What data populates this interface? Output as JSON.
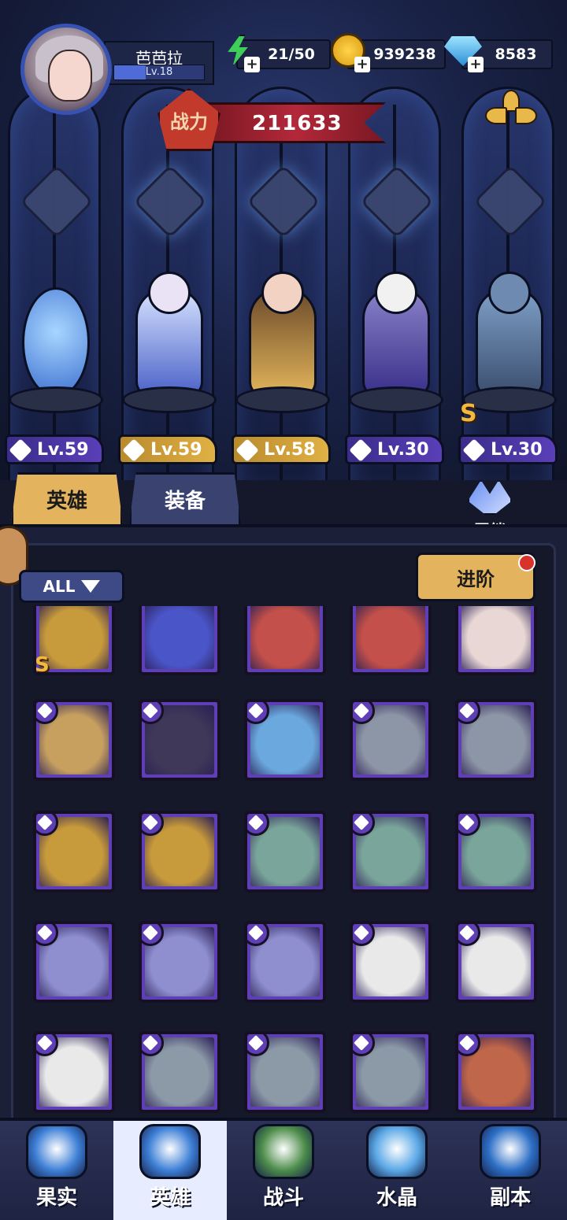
{
  "player": {
    "name": "芭芭拉",
    "level": "Lv.18",
    "level_progress": 0.35
  },
  "resources": {
    "energy": "21/50",
    "gold": "939238",
    "gems": "8583"
  },
  "power": {
    "label": "战力",
    "value": "211633"
  },
  "lineup": [
    {
      "level": "Lv.59",
      "class_icon": "wrench-icon",
      "color": "#4b3aa8"
    },
    {
      "level": "Lv.59",
      "class_icon": "hat-icon",
      "color": "#c89435"
    },
    {
      "level": "Lv.58",
      "class_icon": "wing-icon",
      "color": "#c89435"
    },
    {
      "level": "Lv.30",
      "class_icon": "hat-icon",
      "color": "#4b3aa8"
    },
    {
      "level": "Lv.30",
      "class_icon": "claw-icon",
      "color": "#4b3aa8"
    }
  ],
  "tabs": {
    "heroes": "英雄",
    "equipment": "装备",
    "bond": "羁绊"
  },
  "filter": "ALL",
  "advance": "进阶",
  "grid": [
    {
      "portrait": "#c79a3b",
      "cls": false,
      "s": true
    },
    {
      "portrait": "#4a55c8",
      "cls": false,
      "s": false
    },
    {
      "portrait": "#c3504a",
      "cls": false,
      "s": false
    },
    {
      "portrait": "#c3504a",
      "cls": false,
      "s": false
    },
    {
      "portrait": "#e8d7d4",
      "cls": false,
      "s": false
    },
    {
      "portrait": "#c7a060",
      "cls": true,
      "s": false
    },
    {
      "portrait": "#3f3858",
      "cls": true,
      "s": false
    },
    {
      "portrait": "#6aa8de",
      "cls": true,
      "s": false
    },
    {
      "portrait": "#8d96a6",
      "cls": true,
      "s": false
    },
    {
      "portrait": "#8d96a6",
      "cls": true,
      "s": false
    },
    {
      "portrait": "#c79a3b",
      "cls": true,
      "s": false
    },
    {
      "portrait": "#c79a3b",
      "cls": true,
      "s": false
    },
    {
      "portrait": "#7aa59a",
      "cls": true,
      "s": false
    },
    {
      "portrait": "#7aa59a",
      "cls": true,
      "s": false
    },
    {
      "portrait": "#7aa59a",
      "cls": true,
      "s": false
    },
    {
      "portrait": "#8f8fd0",
      "cls": true,
      "s": false
    },
    {
      "portrait": "#8f8fd0",
      "cls": true,
      "s": false
    },
    {
      "portrait": "#8f8fd0",
      "cls": true,
      "s": false
    },
    {
      "portrait": "#e9e9e9",
      "cls": true,
      "s": false
    },
    {
      "portrait": "#e9e9e9",
      "cls": true,
      "s": false
    },
    {
      "portrait": "#e9e9e9",
      "cls": true,
      "s": false
    },
    {
      "portrait": "#8c9aa8",
      "cls": true,
      "s": false
    },
    {
      "portrait": "#8c9aa8",
      "cls": true,
      "s": false
    },
    {
      "portrait": "#8c9aa8",
      "cls": true,
      "s": false
    },
    {
      "portrait": "#c0664a",
      "cls": true,
      "s": false
    }
  ],
  "nav": [
    {
      "label": "果实",
      "icon": "fruit-icon",
      "color": "#3d7fd6"
    },
    {
      "label": "英雄",
      "icon": "hero-icon",
      "color": "#3d7fd6"
    },
    {
      "label": "战斗",
      "icon": "battle-icon",
      "color": "#4c8c4a"
    },
    {
      "label": "水晶",
      "icon": "crystal-icon",
      "color": "#5aa7e6"
    },
    {
      "label": "副本",
      "icon": "dungeon-icon",
      "color": "#2d6fc6"
    }
  ],
  "nav_active": 1
}
